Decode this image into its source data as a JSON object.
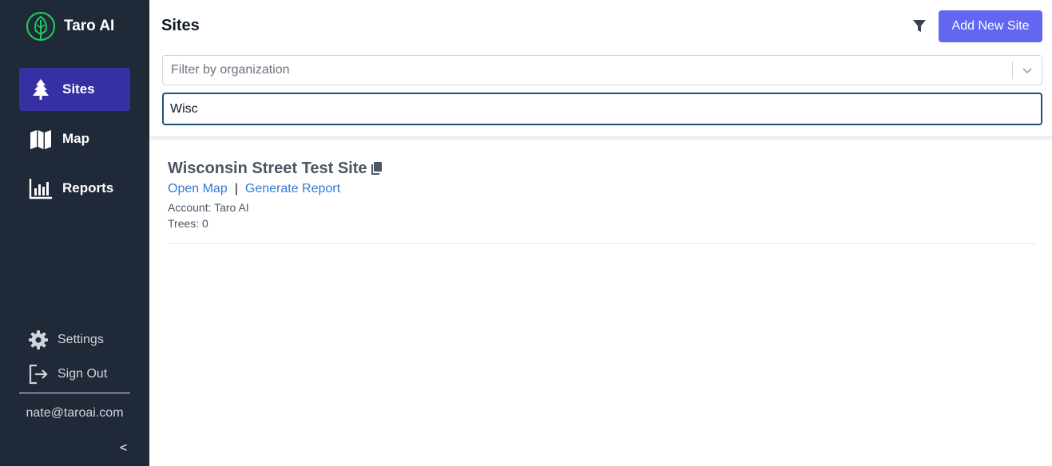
{
  "app": {
    "name": "Taro AI"
  },
  "sidebar": {
    "nav": [
      {
        "label": "Sites",
        "icon": "tree-icon",
        "active": true
      },
      {
        "label": "Map",
        "icon": "map-icon",
        "active": false
      },
      {
        "label": "Reports",
        "icon": "chart-bar-icon",
        "active": false
      }
    ],
    "settings_label": "Settings",
    "signout_label": "Sign Out",
    "user_email": "nate@taroai.com",
    "collapse_label": "<"
  },
  "header": {
    "title": "Sites",
    "add_button": "Add New Site",
    "org_filter_placeholder": "Filter by organization",
    "search_value": "Wisc"
  },
  "sites": [
    {
      "name": "Wisconsin Street Test Site",
      "open_map": "Open Map",
      "separator": "|",
      "generate_report": "Generate Report",
      "account": "Account: Taro AI",
      "trees": "Trees: 0"
    }
  ],
  "colors": {
    "sidebar_bg": "#1f2937",
    "active_nav": "#3730a3",
    "primary_button": "#6366f1",
    "link": "#2f7bd8",
    "logo_green": "#22c55e"
  }
}
